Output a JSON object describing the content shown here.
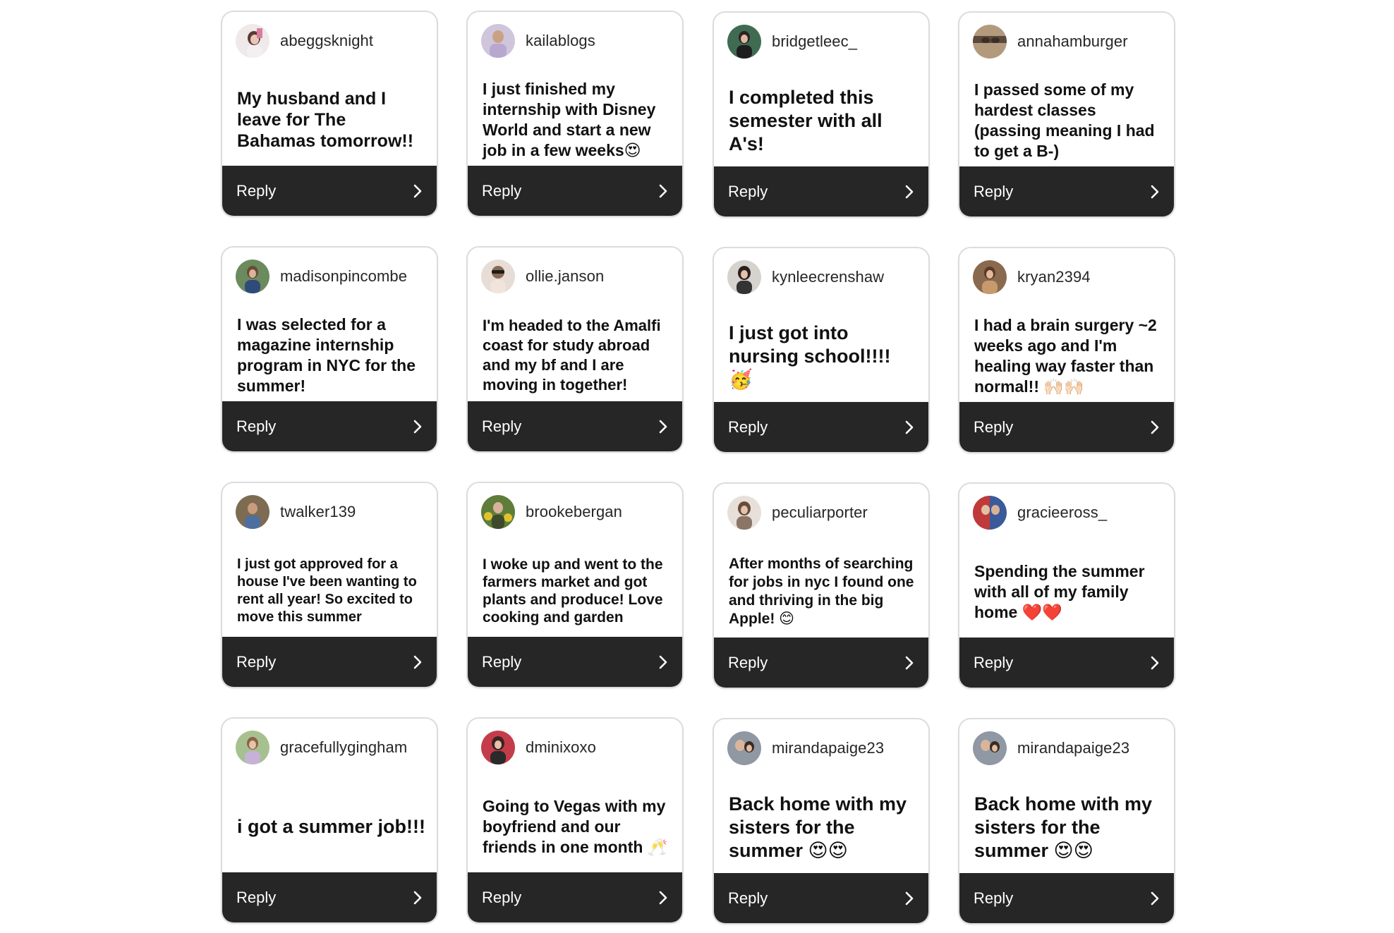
{
  "reply_label": "Reply",
  "colors": {
    "reply_bar": "#262626",
    "card_border": "#dcdcdc",
    "text": "#111111"
  },
  "cards": [
    {
      "username": "abeggsknight",
      "message": "My husband and I leave for The Bahamas tomorrow!!",
      "avatar": "avatar-photo"
    },
    {
      "username": "kailablogs",
      "message": "I just finished my internship with Disney World and start a new job in a few weeks😍",
      "avatar": "avatar-photo"
    },
    {
      "username": "bridgetleec_",
      "message": "I completed this semester with all A's!",
      "avatar": "avatar-photo"
    },
    {
      "username": "annahamburger",
      "message": "I passed some of my hardest classes (passing meaning I had to get a B-)",
      "avatar": "avatar-photo"
    },
    {
      "username": "madisonpincombe",
      "message": "I was selected for a magazine internship program in NYC for the summer!",
      "avatar": "avatar-photo"
    },
    {
      "username": "ollie.janson",
      "message": "I'm headed to the Amalfi coast for study abroad and my bf and I are moving in together!",
      "avatar": "avatar-photo"
    },
    {
      "username": "kynleecrenshaw",
      "message": "I just got into nursing school!!!! 🥳",
      "avatar": "avatar-photo"
    },
    {
      "username": "kryan2394",
      "message": "I had a brain surgery ~2 weeks ago and I'm healing way faster than normal!! 🙌🏻🙌🏻",
      "avatar": "avatar-photo"
    },
    {
      "username": "twalker139",
      "message": "I just got approved for a house I've been wanting to rent all year! So excited to move this summer",
      "avatar": "avatar-photo"
    },
    {
      "username": "brookebergan",
      "message": "I woke up and went to the farmers market and got plants and produce! Love cooking and garden",
      "avatar": "avatar-photo"
    },
    {
      "username": "peculiarporter",
      "message": "After months of searching for jobs in nyc I found one and thriving in the big Apple! 😊",
      "avatar": "avatar-photo"
    },
    {
      "username": "gracieeross_",
      "message": "Spending the summer with all of my family home ❤️❤️",
      "avatar": "avatar-photo"
    },
    {
      "username": "gracefullygingham",
      "message": "i got a summer job!!!",
      "avatar": "avatar-photo"
    },
    {
      "username": "dminixoxo",
      "message": "Going to Vegas with my boyfriend and our friends in one month 🥂",
      "avatar": "avatar-photo"
    },
    {
      "username": "mirandapaige23",
      "message": "Back home with my sisters for the summer 😍😍",
      "avatar": "avatar-photo"
    },
    {
      "username": "mirandapaige23",
      "message": "Back home with my sisters for the summer 😍😍",
      "avatar": "avatar-photo"
    }
  ]
}
